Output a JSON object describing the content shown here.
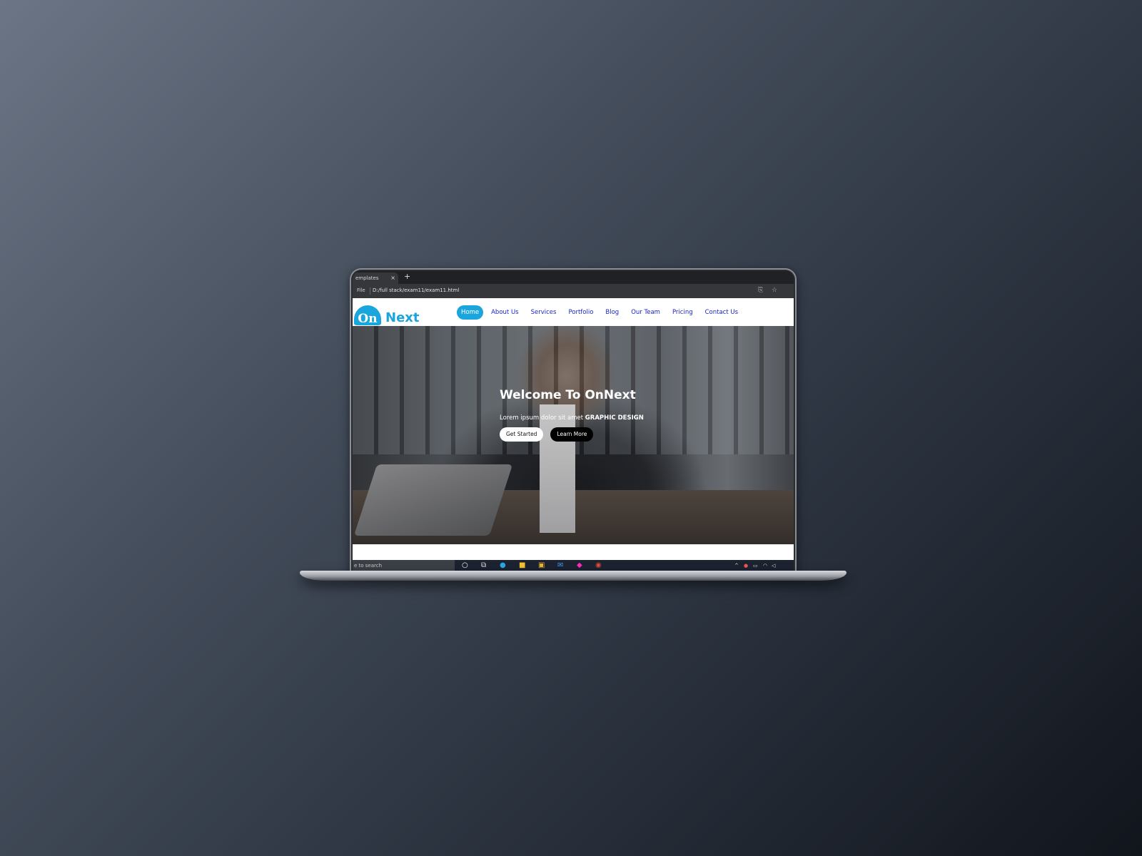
{
  "browser": {
    "tab_title": "emplates",
    "tab_close": "×",
    "new_tab": "+",
    "address_prefix": "File",
    "url": "D:/full stack/exam11/exam11.html"
  },
  "site": {
    "logo_mark": "On",
    "logo_text": "Next",
    "nav": [
      {
        "label": "Home",
        "active": true
      },
      {
        "label": "About Us"
      },
      {
        "label": "Services"
      },
      {
        "label": "Portfolio"
      },
      {
        "label": "Blog"
      },
      {
        "label": "Our Team"
      },
      {
        "label": "Pricing"
      },
      {
        "label": "Contact Us"
      }
    ],
    "hero": {
      "title": "Welcome To OnNext",
      "subtitle_prefix": "Lorem ipsum dolor sit amet",
      "subtitle_bold": "GRAPHIC DESIGN",
      "btn_primary": "Get Started",
      "btn_secondary": "Learn More"
    }
  },
  "taskbar": {
    "search_placeholder": "e to search"
  },
  "colors": {
    "accent": "#1aa5dc",
    "nav_link": "#1a25c7"
  }
}
